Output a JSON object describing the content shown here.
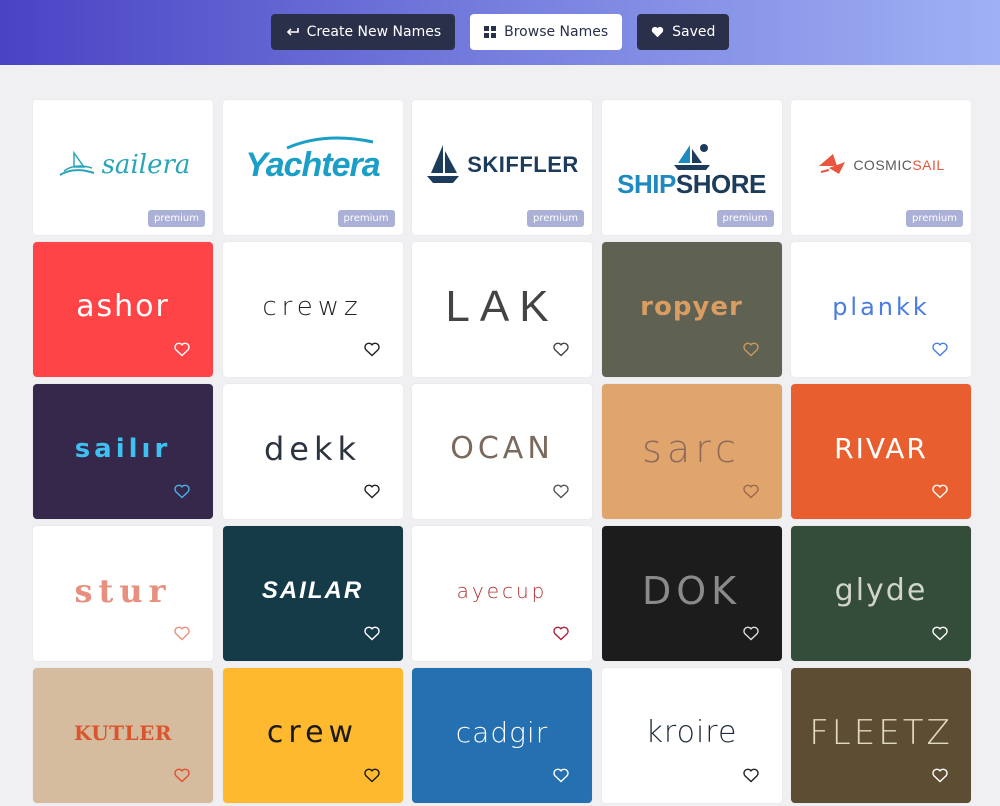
{
  "nav": {
    "create_label": "Create New Names",
    "browse_label": "Browse Names",
    "saved_label": "Saved"
  },
  "premium_badge": "premium",
  "cards": [
    {
      "name": "sailera",
      "premium": true,
      "bg": "#ffffff"
    },
    {
      "name": "Yachtera",
      "premium": true,
      "bg": "#ffffff"
    },
    {
      "name": "SKIFFLER",
      "premium": true,
      "bg": "#ffffff"
    },
    {
      "name_part1": "SHIP",
      "name_part2": "SHORE",
      "premium": true,
      "bg": "#ffffff"
    },
    {
      "name_part1": "COSMIC",
      "name_part2": "SAIL",
      "premium": true,
      "bg": "#ffffff"
    },
    {
      "name": "ashor",
      "bg": "#ff4447",
      "heart": "#ffffff"
    },
    {
      "name": "crewz",
      "bg": "#ffffff",
      "heart": "#222222"
    },
    {
      "name": "LAK",
      "bg": "#ffffff",
      "heart": "#444444"
    },
    {
      "name": "ropyer",
      "bg": "#5f6152",
      "heart": "#c99a5c"
    },
    {
      "name": "plankk",
      "bg": "#ffffff",
      "heart": "#4a7de0"
    },
    {
      "name": "sailır",
      "bg": "#35284b",
      "heart": "#4ab0e8"
    },
    {
      "name": "dekk",
      "bg": "#ffffff",
      "heart": "#222222"
    },
    {
      "name": "OCAN",
      "bg": "#ffffff",
      "heart": "#555555"
    },
    {
      "name": "sarc",
      "bg": "#dfa56c",
      "heart": "#9a6a4a"
    },
    {
      "name": "RIVAR",
      "bg": "#e85e2e",
      "heart": "#ffffff"
    },
    {
      "name": "stur",
      "bg": "#ffffff",
      "heart": "#e89080"
    },
    {
      "name": "SAILAR",
      "bg": "#153a48",
      "heart": "#ffffff"
    },
    {
      "name": "ayecup",
      "bg": "#ffffff",
      "heart": "#b02040"
    },
    {
      "name": "DOK",
      "bg": "#1c1c1c",
      "heart": "#dddddd"
    },
    {
      "name": "glyde",
      "bg": "#344c3a",
      "heart": "#ffffff"
    },
    {
      "name": "KUTLER",
      "bg": "#d6bc9e",
      "heart": "#e05030"
    },
    {
      "name": "crew",
      "bg": "#ffb92e",
      "heart": "#1a1a1a"
    },
    {
      "name": "cadgir",
      "bg": "#2470b0",
      "heart": "#ffffff"
    },
    {
      "name": "kroire",
      "bg": "#ffffff",
      "heart": "#222222"
    },
    {
      "name": "FLEETZ",
      "bg": "#5d4d33",
      "heart": "#ffffff"
    }
  ],
  "colors": {
    "header_gradient_start": "#4a43c4",
    "header_gradient_end": "#a0b0f4",
    "nav_dark": "#2a2f4a",
    "page_bg": "#f0f0f3"
  }
}
